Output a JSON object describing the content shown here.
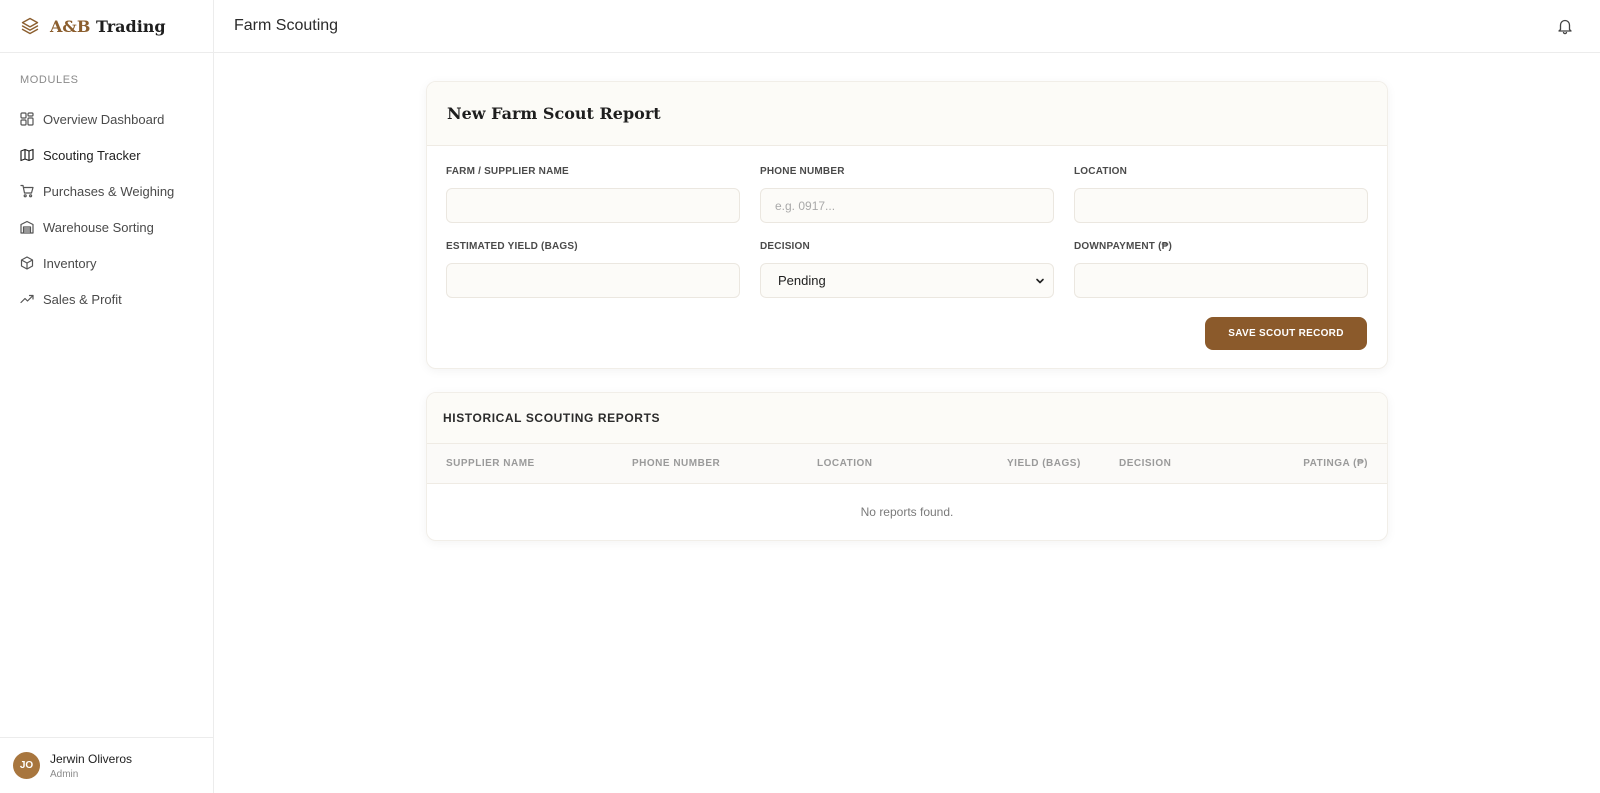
{
  "brand": {
    "part_a": "A&B",
    "part_b": " Trading"
  },
  "sidebar": {
    "section_label": "MODULES",
    "items": [
      {
        "label": "Overview Dashboard",
        "icon": "grid-icon"
      },
      {
        "label": "Scouting Tracker",
        "icon": "map-icon",
        "active": true
      },
      {
        "label": "Purchases & Weighing",
        "icon": "cart-icon"
      },
      {
        "label": "Warehouse Sorting",
        "icon": "warehouse-icon"
      },
      {
        "label": "Inventory",
        "icon": "box-icon"
      },
      {
        "label": "Sales & Profit",
        "icon": "trending-up-icon"
      }
    ]
  },
  "user": {
    "initials": "JO",
    "name": "Jerwin Oliveros",
    "role": "Admin"
  },
  "topbar": {
    "title": "Farm Scouting",
    "icon": "bell-icon"
  },
  "form": {
    "title": "New Farm Scout Report",
    "fields": {
      "farm_name": {
        "label": "FARM / SUPPLIER NAME",
        "value": "",
        "placeholder": ""
      },
      "phone": {
        "label": "PHONE NUMBER",
        "value": "",
        "placeholder": "e.g. 0917..."
      },
      "location": {
        "label": "LOCATION",
        "value": "",
        "placeholder": ""
      },
      "yield": {
        "label": "ESTIMATED YIELD (BAGS)",
        "value": "",
        "placeholder": ""
      },
      "decision": {
        "label": "DECISION",
        "value": "Pending"
      },
      "downpayment": {
        "label": "DOWNPAYMENT (₱)",
        "value": "",
        "placeholder": ""
      }
    },
    "save_label": "SAVE SCOUT RECORD"
  },
  "table": {
    "title": "HISTORICAL SCOUTING REPORTS",
    "columns": [
      "SUPPLIER NAME",
      "PHONE NUMBER",
      "LOCATION",
      "YIELD (BAGS)",
      "DECISION",
      "PATINGA (₱)"
    ],
    "rows": [],
    "empty_text": "No reports found."
  },
  "colors": {
    "accent": "#8b5a2b",
    "brand_gold": "#8b5e2e",
    "avatar": "#a8763e"
  }
}
